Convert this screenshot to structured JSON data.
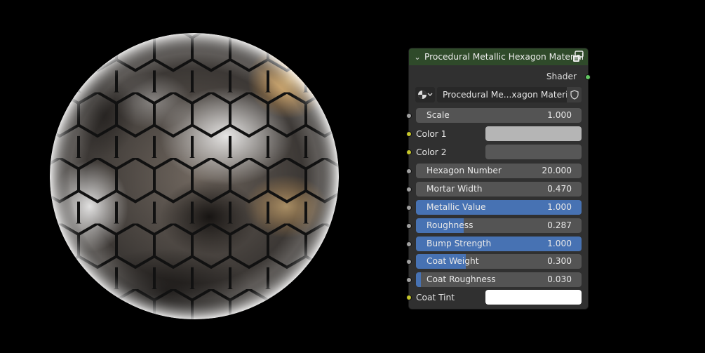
{
  "node": {
    "title": "Procedural Metallic Hexagon Material",
    "header_color": "#2f4a2a",
    "output_label": "Shader",
    "material_name": "Procedural Me...xagon Material",
    "inputs": [
      {
        "label": "Scale",
        "value": "1.000",
        "fraction": 0
      },
      {
        "label": "Hexagon Number",
        "value": "20.000",
        "fraction": 0
      },
      {
        "label": "Mortar Width",
        "value": "0.470",
        "fraction": 0
      },
      {
        "label": "Metallic Value",
        "value": "1.000",
        "fraction": 1.0
      },
      {
        "label": "Roughness",
        "value": "0.287",
        "fraction": 0.287
      },
      {
        "label": "Bump Strength",
        "value": "1.000",
        "fraction": 1.0
      },
      {
        "label": "Coat Weight",
        "value": "0.300",
        "fraction": 0.3
      },
      {
        "label": "Coat Roughness",
        "value": "0.030",
        "fraction": 0.03
      }
    ],
    "colors": [
      {
        "label": "Color 1",
        "swatch": "#b5b5b5"
      },
      {
        "label": "Color 2",
        "swatch": "#575757"
      },
      {
        "label": "Coat Tint",
        "swatch": "#ffffff"
      }
    ]
  }
}
